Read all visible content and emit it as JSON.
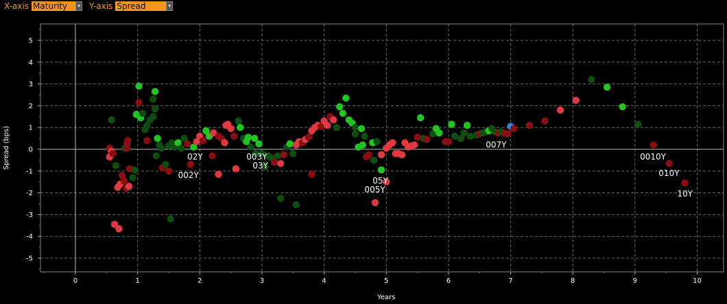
{
  "controls": {
    "x_axis_label": "X-axis",
    "x_axis_value": "Maturity",
    "y_axis_label": "Y-axis",
    "y_axis_value": "Spread"
  },
  "colors": {
    "accent": "#f39c12",
    "select_bg": "#f7941d",
    "dark_green": "#0f4d12",
    "bright_green": "#22c422",
    "dark_red": "#8b0f12",
    "bright_red": "#e03a40",
    "blue": "#3b7dd8"
  },
  "chart_data": {
    "type": "scatter",
    "xlabel": "Years",
    "ylabel": "Spread (bps)",
    "xlim": [
      -0.5,
      10.45
    ],
    "ylim": [
      -5.6,
      5.6
    ],
    "xticks": [
      0,
      1,
      2,
      3,
      4,
      5,
      6,
      7,
      8,
      9,
      10
    ],
    "yticks": [
      5,
      4,
      3,
      2,
      1,
      0,
      -1,
      -2,
      -3,
      -4,
      -5
    ],
    "grid": true,
    "legend": "none",
    "points": [
      {
        "x": 0.58,
        "y": 1.35,
        "c": "g"
      },
      {
        "x": 0.55,
        "y": 0.05,
        "c": "r"
      },
      {
        "x": 0.58,
        "y": -0.1,
        "c": "R"
      },
      {
        "x": 0.55,
        "y": -0.35,
        "c": "R"
      },
      {
        "x": 0.6,
        "y": -0.2,
        "c": "r"
      },
      {
        "x": 0.63,
        "y": -3.45,
        "c": "R"
      },
      {
        "x": 0.7,
        "y": -3.65,
        "c": "R"
      },
      {
        "x": 0.68,
        "y": -1.75,
        "c": "R"
      },
      {
        "x": 0.72,
        "y": -1.6,
        "c": "R"
      },
      {
        "x": 0.65,
        "y": -0.75,
        "c": "g"
      },
      {
        "x": 0.75,
        "y": -1.2,
        "c": "r"
      },
      {
        "x": 0.78,
        "y": -1.45,
        "c": "r"
      },
      {
        "x": 0.82,
        "y": -1.8,
        "c": "r"
      },
      {
        "x": 0.86,
        "y": -1.7,
        "c": "R"
      },
      {
        "x": 0.8,
        "y": 0.05,
        "c": "g"
      },
      {
        "x": 0.83,
        "y": 0.25,
        "c": "r"
      },
      {
        "x": 0.84,
        "y": 0.4,
        "c": "r"
      },
      {
        "x": 0.87,
        "y": -0.9,
        "c": "r"
      },
      {
        "x": 0.95,
        "y": -0.95,
        "c": "g"
      },
      {
        "x": 0.92,
        "y": -1.3,
        "c": "g"
      },
      {
        "x": 0.83,
        "y": 0.05,
        "c": "r"
      },
      {
        "x": 1.02,
        "y": 2.9,
        "c": "G"
      },
      {
        "x": 1.02,
        "y": 2.15,
        "c": "r"
      },
      {
        "x": 0.98,
        "y": 1.6,
        "c": "G"
      },
      {
        "x": 1.05,
        "y": 1.45,
        "c": "G"
      },
      {
        "x": 1.08,
        "y": 1.65,
        "c": "g"
      },
      {
        "x": 1.12,
        "y": 0.9,
        "c": "g"
      },
      {
        "x": 1.15,
        "y": 1.1,
        "c": "g"
      },
      {
        "x": 1.2,
        "y": 1.35,
        "c": "g"
      },
      {
        "x": 1.25,
        "y": 1.5,
        "c": "g"
      },
      {
        "x": 1.25,
        "y": 2.3,
        "c": "g"
      },
      {
        "x": 1.28,
        "y": 2.65,
        "c": "G"
      },
      {
        "x": 1.28,
        "y": 1.85,
        "c": "g"
      },
      {
        "x": 1.15,
        "y": 0.4,
        "c": "r"
      },
      {
        "x": 1.3,
        "y": -0.3,
        "c": "g"
      },
      {
        "x": 1.35,
        "y": 0.2,
        "c": "g"
      },
      {
        "x": 1.32,
        "y": 0.5,
        "c": "G"
      },
      {
        "x": 1.38,
        "y": 0.05,
        "c": "g"
      },
      {
        "x": 1.4,
        "y": -0.85,
        "c": "r"
      },
      {
        "x": 1.45,
        "y": -0.7,
        "c": "g"
      },
      {
        "x": 1.5,
        "y": -1.0,
        "c": "r"
      },
      {
        "x": 1.5,
        "y": 0.15,
        "c": "g"
      },
      {
        "x": 1.55,
        "y": 0.3,
        "c": "g"
      },
      {
        "x": 1.6,
        "y": 0.1,
        "c": "g"
      },
      {
        "x": 1.65,
        "y": 0.3,
        "c": "G"
      },
      {
        "x": 1.53,
        "y": -3.2,
        "c": "g"
      },
      {
        "x": 1.7,
        "y": 0.05,
        "c": "g"
      },
      {
        "x": 1.75,
        "y": 0.5,
        "c": "g"
      },
      {
        "x": 1.8,
        "y": 0.25,
        "c": "r"
      },
      {
        "x": 1.85,
        "y": -0.7,
        "c": "r"
      },
      {
        "x": 1.9,
        "y": 0.1,
        "c": "G"
      },
      {
        "x": 1.95,
        "y": 0.35,
        "c": "R"
      },
      {
        "x": 2.0,
        "y": 0.6,
        "c": "R"
      },
      {
        "x": 2.05,
        "y": 0.4,
        "c": "r"
      },
      {
        "x": 2.1,
        "y": 0.85,
        "c": "G"
      },
      {
        "x": 2.15,
        "y": 0.6,
        "c": "G"
      },
      {
        "x": 2.2,
        "y": -0.3,
        "c": "r"
      },
      {
        "x": 2.22,
        "y": 0.75,
        "c": "R"
      },
      {
        "x": 2.3,
        "y": 0.6,
        "c": "r"
      },
      {
        "x": 2.3,
        "y": -1.15,
        "c": "R"
      },
      {
        "x": 2.35,
        "y": 0.5,
        "c": "r"
      },
      {
        "x": 2.4,
        "y": 0.3,
        "c": "R"
      },
      {
        "x": 2.42,
        "y": 1.1,
        "c": "R"
      },
      {
        "x": 2.45,
        "y": 1.15,
        "c": "R"
      },
      {
        "x": 2.5,
        "y": 0.95,
        "c": "R"
      },
      {
        "x": 2.55,
        "y": 0.6,
        "c": "r"
      },
      {
        "x": 2.58,
        "y": -0.9,
        "c": "R"
      },
      {
        "x": 2.62,
        "y": 1.3,
        "c": "g"
      },
      {
        "x": 2.65,
        "y": 1.0,
        "c": "G"
      },
      {
        "x": 2.7,
        "y": 0.5,
        "c": "g"
      },
      {
        "x": 2.75,
        "y": 0.35,
        "c": "G"
      },
      {
        "x": 2.78,
        "y": 0.55,
        "c": "G"
      },
      {
        "x": 2.82,
        "y": 0.1,
        "c": "g"
      },
      {
        "x": 2.88,
        "y": 0.5,
        "c": "G"
      },
      {
        "x": 2.9,
        "y": -0.2,
        "c": "g"
      },
      {
        "x": 2.95,
        "y": 0.25,
        "c": "G"
      },
      {
        "x": 3.0,
        "y": -0.2,
        "c": "g"
      },
      {
        "x": 3.05,
        "y": -0.8,
        "c": "g"
      },
      {
        "x": 3.1,
        "y": -0.3,
        "c": "g"
      },
      {
        "x": 3.15,
        "y": -0.4,
        "c": "g"
      },
      {
        "x": 3.2,
        "y": -0.6,
        "c": "r"
      },
      {
        "x": 3.25,
        "y": -0.3,
        "c": "g"
      },
      {
        "x": 3.3,
        "y": -2.25,
        "c": "g"
      },
      {
        "x": 3.3,
        "y": -0.65,
        "c": "R"
      },
      {
        "x": 3.35,
        "y": -0.25,
        "c": "r"
      },
      {
        "x": 3.4,
        "y": 0.1,
        "c": "g"
      },
      {
        "x": 3.45,
        "y": 0.25,
        "c": "G"
      },
      {
        "x": 3.5,
        "y": -0.2,
        "c": "g"
      },
      {
        "x": 3.55,
        "y": -2.55,
        "c": "g"
      },
      {
        "x": 3.55,
        "y": 0.2,
        "c": "R"
      },
      {
        "x": 3.6,
        "y": 0.35,
        "c": "R"
      },
      {
        "x": 3.65,
        "y": 0.3,
        "c": "r"
      },
      {
        "x": 3.7,
        "y": 0.45,
        "c": "R"
      },
      {
        "x": 3.75,
        "y": 0.55,
        "c": "r"
      },
      {
        "x": 3.8,
        "y": 0.85,
        "c": "R"
      },
      {
        "x": 3.8,
        "y": -1.15,
        "c": "r"
      },
      {
        "x": 3.85,
        "y": 1.0,
        "c": "R"
      },
      {
        "x": 3.9,
        "y": 1.1,
        "c": "R"
      },
      {
        "x": 3.95,
        "y": 1.05,
        "c": "r"
      },
      {
        "x": 4.0,
        "y": 1.3,
        "c": "R"
      },
      {
        "x": 4.05,
        "y": 1.1,
        "c": "R"
      },
      {
        "x": 4.1,
        "y": 1.5,
        "c": "r"
      },
      {
        "x": 4.15,
        "y": 1.35,
        "c": "R"
      },
      {
        "x": 4.2,
        "y": 1.0,
        "c": "g"
      },
      {
        "x": 4.25,
        "y": 1.95,
        "c": "G"
      },
      {
        "x": 4.3,
        "y": 1.65,
        "c": "G"
      },
      {
        "x": 4.35,
        "y": 2.35,
        "c": "G"
      },
      {
        "x": 4.4,
        "y": 1.35,
        "c": "G"
      },
      {
        "x": 4.45,
        "y": 1.2,
        "c": "G"
      },
      {
        "x": 4.5,
        "y": 1.0,
        "c": "g"
      },
      {
        "x": 4.5,
        "y": 0.7,
        "c": "g"
      },
      {
        "x": 4.55,
        "y": 0.1,
        "c": "G"
      },
      {
        "x": 4.6,
        "y": 0.95,
        "c": "G"
      },
      {
        "x": 4.62,
        "y": 0.2,
        "c": "G"
      },
      {
        "x": 4.65,
        "y": 0.6,
        "c": "g"
      },
      {
        "x": 4.68,
        "y": -0.35,
        "c": "r"
      },
      {
        "x": 4.72,
        "y": -0.25,
        "c": "r"
      },
      {
        "x": 4.78,
        "y": 0.3,
        "c": "G"
      },
      {
        "x": 4.8,
        "y": -0.5,
        "c": "g"
      },
      {
        "x": 4.85,
        "y": 0.35,
        "c": "g"
      },
      {
        "x": 4.82,
        "y": -2.45,
        "c": "R"
      },
      {
        "x": 4.92,
        "y": -0.95,
        "c": "G"
      },
      {
        "x": 4.92,
        "y": -0.25,
        "c": "R"
      },
      {
        "x": 5.0,
        "y": 0.05,
        "c": "R"
      },
      {
        "x": 5.0,
        "y": -1.5,
        "c": "R"
      },
      {
        "x": 5.05,
        "y": 0.2,
        "c": "R"
      },
      {
        "x": 5.1,
        "y": 0.3,
        "c": "R"
      },
      {
        "x": 5.15,
        "y": -0.2,
        "c": "R"
      },
      {
        "x": 5.2,
        "y": -0.2,
        "c": "R"
      },
      {
        "x": 5.25,
        "y": -0.25,
        "c": "R"
      },
      {
        "x": 5.3,
        "y": 0.3,
        "c": "R"
      },
      {
        "x": 5.35,
        "y": 0.1,
        "c": "R"
      },
      {
        "x": 5.4,
        "y": 0.15,
        "c": "R"
      },
      {
        "x": 5.45,
        "y": 0.2,
        "c": "R"
      },
      {
        "x": 5.5,
        "y": 0.55,
        "c": "r"
      },
      {
        "x": 5.55,
        "y": 1.45,
        "c": "G"
      },
      {
        "x": 5.6,
        "y": 0.5,
        "c": "g"
      },
      {
        "x": 5.65,
        "y": 0.45,
        "c": "r"
      },
      {
        "x": 5.75,
        "y": 0.7,
        "c": "g"
      },
      {
        "x": 5.8,
        "y": 0.95,
        "c": "G"
      },
      {
        "x": 5.85,
        "y": 0.75,
        "c": "G"
      },
      {
        "x": 5.95,
        "y": 0.35,
        "c": "r"
      },
      {
        "x": 6.0,
        "y": 0.35,
        "c": "r"
      },
      {
        "x": 6.05,
        "y": 1.15,
        "c": "G"
      },
      {
        "x": 6.1,
        "y": 0.6,
        "c": "g"
      },
      {
        "x": 6.2,
        "y": 0.5,
        "c": "g"
      },
      {
        "x": 6.25,
        "y": 0.75,
        "c": "g"
      },
      {
        "x": 6.3,
        "y": 1.1,
        "c": "G"
      },
      {
        "x": 6.35,
        "y": 0.6,
        "c": "g"
      },
      {
        "x": 6.45,
        "y": 0.65,
        "c": "g"
      },
      {
        "x": 6.5,
        "y": 0.7,
        "c": "r"
      },
      {
        "x": 6.55,
        "y": 0.75,
        "c": "g"
      },
      {
        "x": 6.6,
        "y": 0.8,
        "c": "g"
      },
      {
        "x": 6.65,
        "y": 0.85,
        "c": "G"
      },
      {
        "x": 6.7,
        "y": 0.95,
        "c": "g"
      },
      {
        "x": 6.75,
        "y": 0.8,
        "c": "g"
      },
      {
        "x": 6.8,
        "y": 0.75,
        "c": "r"
      },
      {
        "x": 6.85,
        "y": 0.8,
        "c": "g"
      },
      {
        "x": 6.9,
        "y": 0.75,
        "c": "r"
      },
      {
        "x": 6.95,
        "y": 0.7,
        "c": "r"
      },
      {
        "x": 7.0,
        "y": 1.05,
        "c": "b"
      },
      {
        "x": 7.05,
        "y": 0.95,
        "c": "r"
      },
      {
        "x": 7.3,
        "y": 1.1,
        "c": "r"
      },
      {
        "x": 7.55,
        "y": 1.3,
        "c": "r"
      },
      {
        "x": 7.8,
        "y": 1.8,
        "c": "R"
      },
      {
        "x": 8.05,
        "y": 2.25,
        "c": "R"
      },
      {
        "x": 8.3,
        "y": 3.2,
        "c": "g"
      },
      {
        "x": 8.55,
        "y": 2.85,
        "c": "G"
      },
      {
        "x": 8.8,
        "y": 1.95,
        "c": "G"
      },
      {
        "x": 9.05,
        "y": 1.15,
        "c": "g"
      },
      {
        "x": 9.3,
        "y": 0.2,
        "c": "r"
      },
      {
        "x": 9.55,
        "y": -0.65,
        "c": "r"
      },
      {
        "x": 9.8,
        "y": -1.55,
        "c": "r"
      }
    ],
    "annotations": [
      {
        "text": "02Y",
        "x": 1.8,
        "y": -0.35
      },
      {
        "text": "002Y",
        "x": 1.65,
        "y": -1.2
      },
      {
        "text": "003Y",
        "x": 2.75,
        "y": -0.35
      },
      {
        "text": "03Y",
        "x": 2.85,
        "y": -0.75
      },
      {
        "text": "007Y",
        "x": 6.6,
        "y": 0.2
      },
      {
        "text": "05Y",
        "x": 4.78,
        "y": -1.45
      },
      {
        "text": "005Y",
        "x": 4.65,
        "y": -1.85
      },
      {
        "text": "0010Y",
        "x": 9.08,
        "y": -0.35
      },
      {
        "text": "010Y",
        "x": 9.38,
        "y": -1.1
      },
      {
        "text": "10Y",
        "x": 9.68,
        "y": -2.05
      }
    ]
  }
}
